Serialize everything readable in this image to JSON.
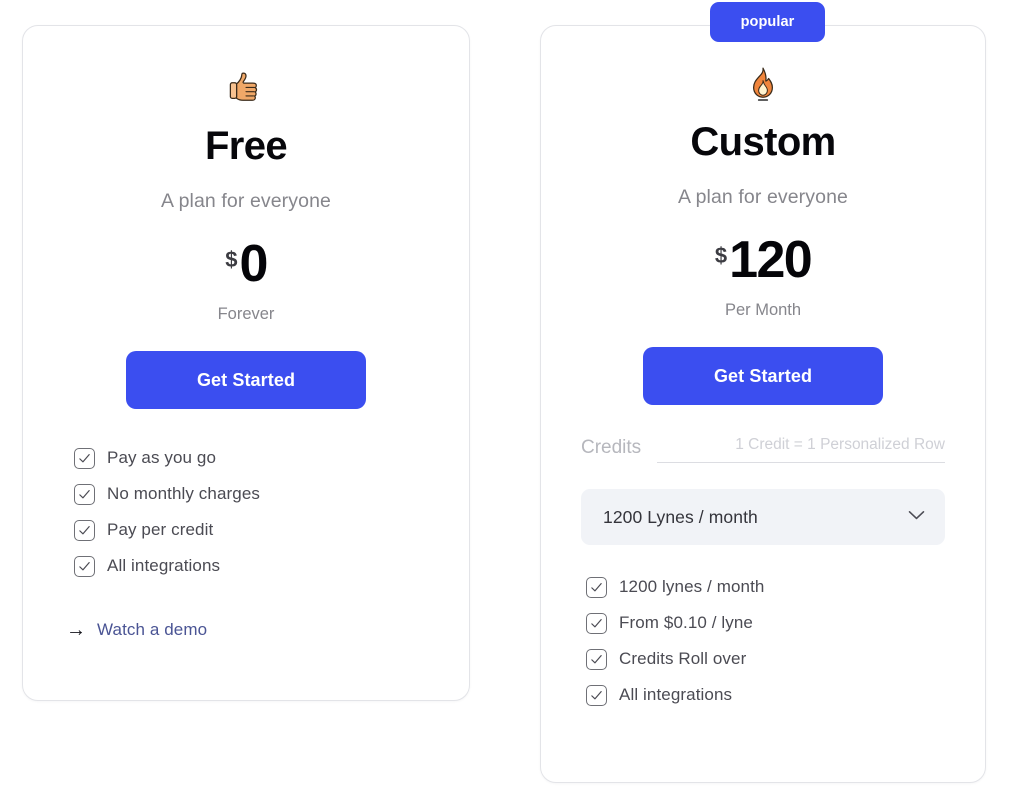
{
  "theme": {
    "accent": "#3b4ef0",
    "card_border": "#e3e4e8",
    "muted_text": "#86868c",
    "feature_text": "#4b4b53",
    "link_text": "#4a5494",
    "select_bg": "#f1f3f7",
    "page_bg": "#ffffff"
  },
  "plans": [
    {
      "id": "free",
      "emoji_name": "thumbs-up-emoji",
      "title": "Free",
      "subtitle": "A plan for everyone",
      "currency": "$",
      "price": "0",
      "period": "Forever",
      "cta_label": "Get Started",
      "features": [
        "Pay as you go",
        "No monthly charges",
        "Pay per credit",
        "All integrations"
      ],
      "demo_arrow": "→",
      "demo_label": "Watch a demo"
    },
    {
      "id": "custom",
      "badge_label": "popular",
      "emoji_name": "fire-emoji",
      "title": "Custom",
      "subtitle": "A plan for everyone",
      "currency": "$",
      "price": "120",
      "period": "Per Month",
      "cta_label": "Get Started",
      "credits_label": "Credits",
      "credits_note": "1 Credit = 1 Personalized Row",
      "select_value": "1200 Lynes / month",
      "features": [
        "1200 lynes / month",
        "From $0.10 / lyne",
        "Credits Roll over",
        "All integrations"
      ]
    }
  ]
}
